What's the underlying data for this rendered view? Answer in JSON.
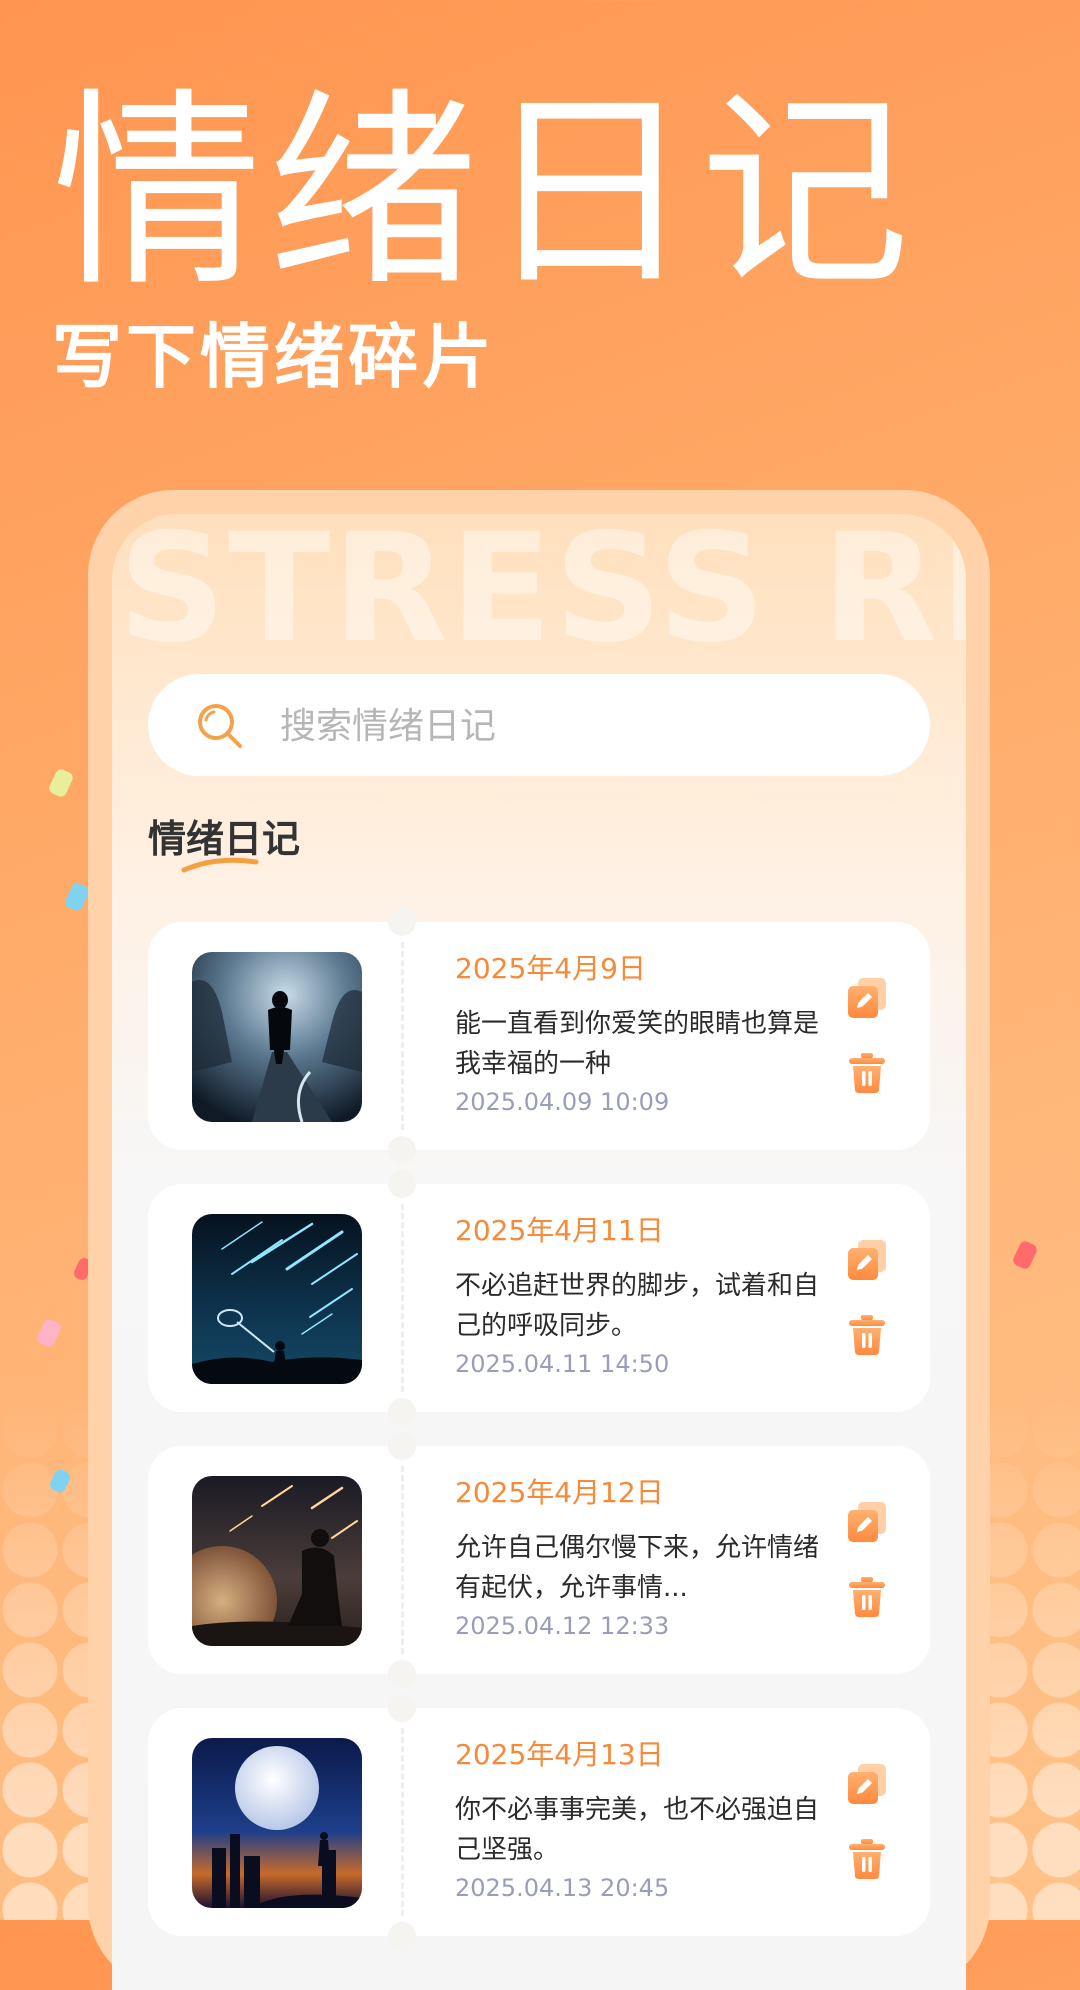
{
  "hero": {
    "title": "情绪日记",
    "subtitle": "写下情绪碎片"
  },
  "screen": {
    "watermark": "STRESS RE",
    "search": {
      "placeholder": "搜索情绪日记",
      "icon": "search-icon"
    },
    "section_title": "情绪日记",
    "entries": [
      {
        "title": "2025年4月9日",
        "text": "能一直看到你爱笑的眼睛也算是我幸福的一种",
        "time": "2025.04.09 10:09",
        "image": "man-walking-foggy-road-night"
      },
      {
        "title": "2025年4月11日",
        "text": "不必追赶世界的脚步，试着和自己的呼吸同步。",
        "time": "2025.04.11 14:50",
        "image": "person-catching-meteors-with-net"
      },
      {
        "title": "2025年4月12日",
        "text": "允许自己偶尔慢下来，允许情绪有起伏，允许事情...",
        "time": "2025.04.12 12:33",
        "image": "man-sitting-under-planet-meteor-shower"
      },
      {
        "title": "2025年4月13日",
        "text": "你不必事事完美，也不必强迫自己坚强。",
        "time": "2025.04.13 20:45",
        "image": "full-moon-over-city-silhouette"
      }
    ]
  },
  "colors": {
    "accent": "#f58a3a",
    "background": "#ffa866",
    "card": "#ffffff",
    "timestamp": "#9a9db8"
  },
  "icons": {
    "edit": "edit-icon",
    "delete": "trash-icon"
  }
}
